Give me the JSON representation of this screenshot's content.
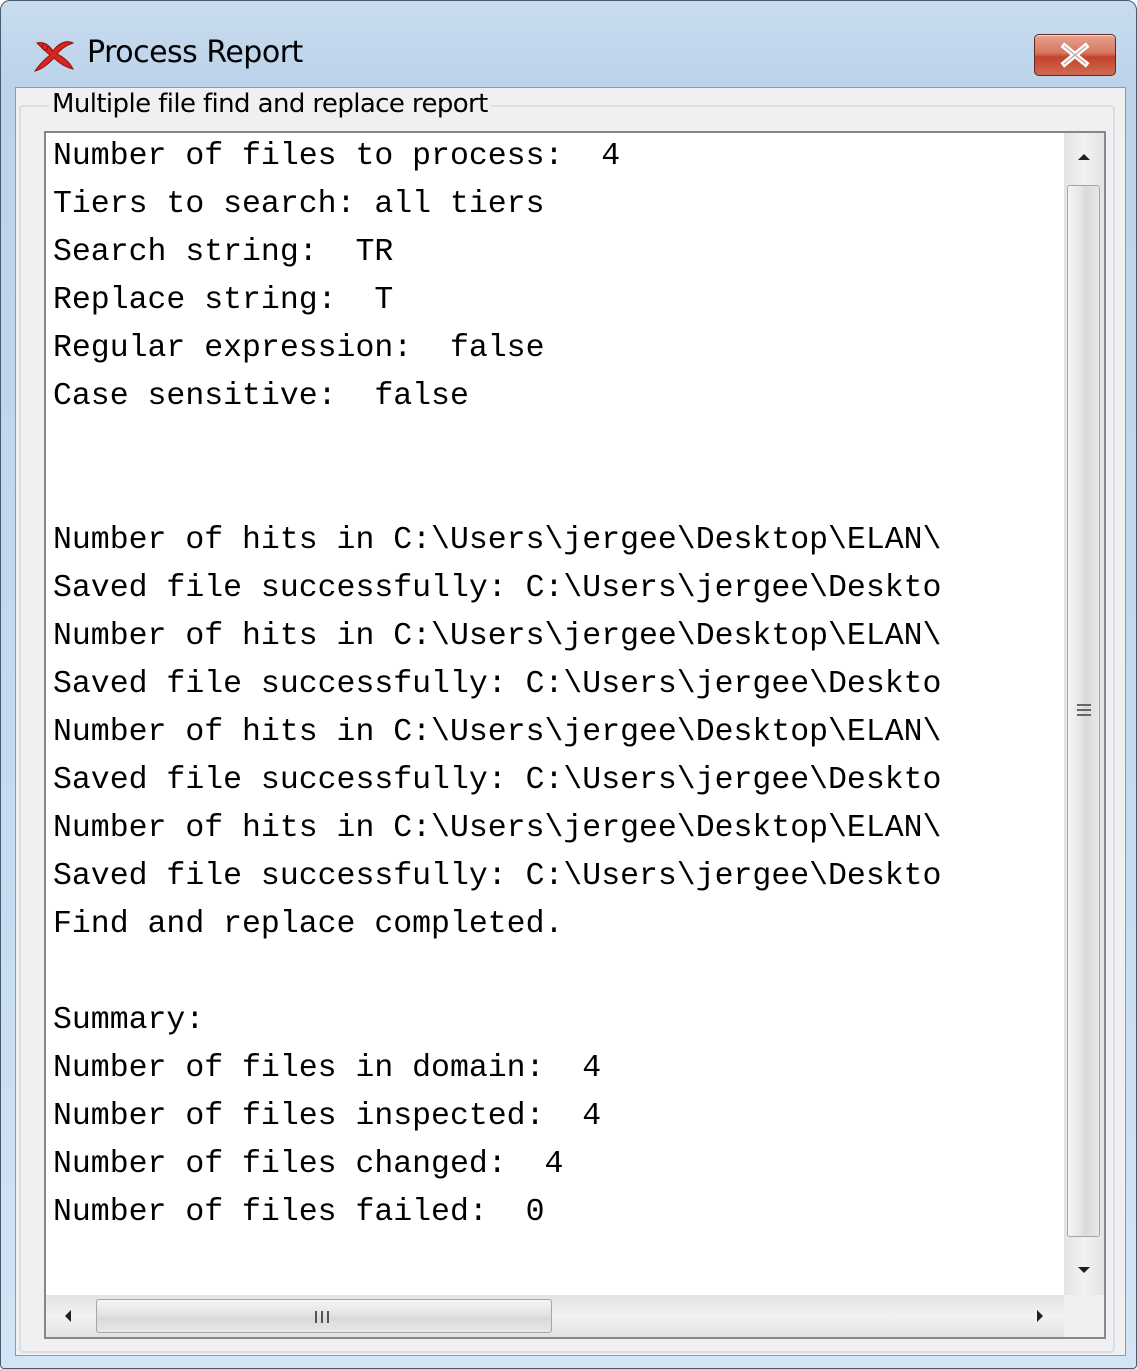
{
  "window": {
    "title": "Process Report",
    "icon": "elan-app-icon",
    "close_icon": "close-icon"
  },
  "group": {
    "label": "Multiple file find and replace report"
  },
  "report": {
    "lines": [
      "Number of files to process:  4",
      "Tiers to search: all tiers",
      "Search string:  TR",
      "Replace string:  T",
      "Regular expression:  false",
      "Case sensitive:  false",
      "",
      "",
      "Number of hits in C:\\Users\\jergee\\Desktop\\ELAN\\",
      "Saved file successfully: C:\\Users\\jergee\\Deskto",
      "Number of hits in C:\\Users\\jergee\\Desktop\\ELAN\\",
      "Saved file successfully: C:\\Users\\jergee\\Deskto",
      "Number of hits in C:\\Users\\jergee\\Desktop\\ELAN\\",
      "Saved file successfully: C:\\Users\\jergee\\Deskto",
      "Number of hits in C:\\Users\\jergee\\Desktop\\ELAN\\",
      "Saved file successfully: C:\\Users\\jergee\\Deskto",
      "Find and replace completed.",
      "",
      "Summary:",
      "Number of files in domain:  4",
      "Number of files inspected:  4",
      "Number of files changed:  4",
      "Number of files failed:  0"
    ]
  },
  "scrollbars": {
    "vertical": {
      "up_icon": "arrow-up-icon",
      "down_icon": "arrow-down-icon",
      "position": 0
    },
    "horizontal": {
      "left_icon": "arrow-left-icon",
      "right_icon": "arrow-right-icon",
      "position": 0
    }
  },
  "colors": {
    "title_bar": "#c6dbf0",
    "close_button": "#c4432b",
    "text": "#000000",
    "text_area_background": "#ffffff"
  }
}
